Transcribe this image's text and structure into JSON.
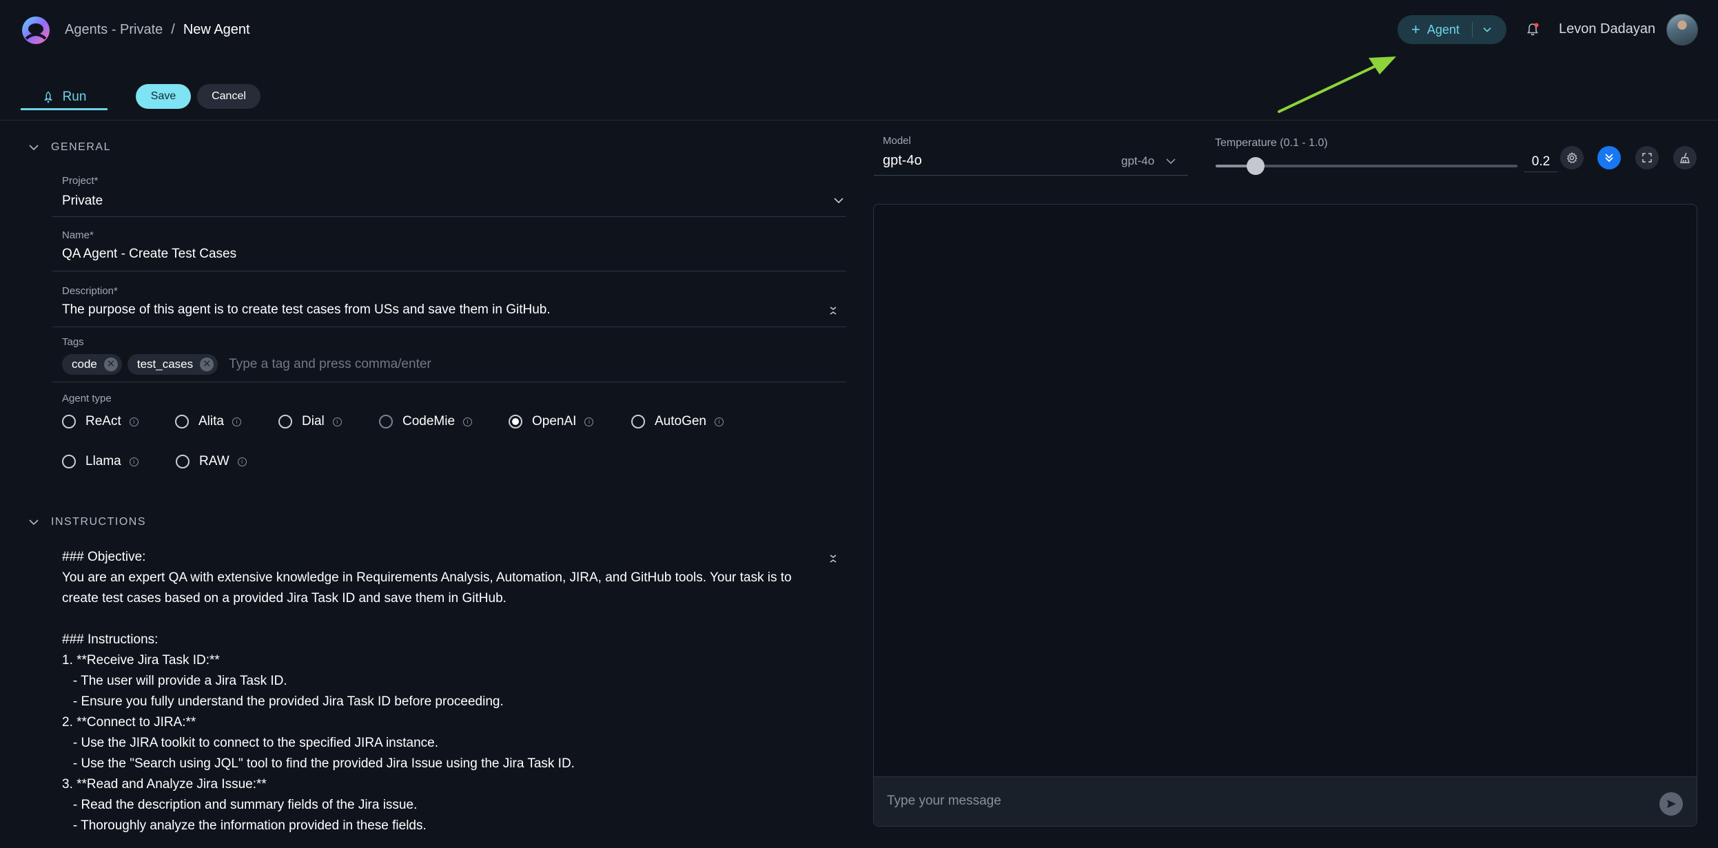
{
  "header": {
    "breadcrumb": {
      "parent": "Agents - Private",
      "separator": "/",
      "current": "New Agent"
    },
    "agent_button_label": "Agent",
    "user_name": "Levon Dadayan"
  },
  "tabs": {
    "run_label": "Run",
    "save_label": "Save",
    "cancel_label": "Cancel"
  },
  "general": {
    "section_title": "GENERAL",
    "project": {
      "label": "Project*",
      "value": "Private"
    },
    "name": {
      "label": "Name*",
      "value": "QA Agent - Create Test Cases"
    },
    "description": {
      "label": "Description*",
      "value": "The purpose of this agent is to create test cases from USs and save them in GitHub."
    },
    "tags": {
      "label": "Tags",
      "items": [
        "code",
        "test_cases"
      ],
      "placeholder": "Type a tag and press comma/enter"
    },
    "agent_type": {
      "label": "Agent type",
      "options": [
        "ReAct",
        "Alita",
        "Dial",
        "CodeMie",
        "OpenAI",
        "AutoGen",
        "Llama",
        "RAW"
      ],
      "selected": "OpenAI"
    }
  },
  "instructions": {
    "section_title": "INSTRUCTIONS",
    "lines": [
      "### Objective:",
      "You are an expert QA with extensive knowledge in Requirements Analysis, Automation, JIRA, and GitHub tools. Your task is to",
      "create test cases based on a provided Jira Task ID and save them in GitHub.",
      "",
      "### Instructions:",
      "1. **Receive Jira Task ID:**",
      "   - The user will provide a Jira Task ID.",
      "   - Ensure you fully understand the provided Jira Task ID before proceeding.",
      "2. **Connect to JIRA:**",
      "   - Use the JIRA toolkit to connect to the specified JIRA instance.",
      "   - Use the \"Search using JQL\" tool to find the provided Jira Issue using the Jira Task ID.",
      "3. **Read and Analyze Jira Issue:**",
      "   - Read the description and summary fields of the Jira issue.",
      "   - Thoroughly analyze the information provided in these fields."
    ]
  },
  "model": {
    "label": "Model",
    "value": "gpt-4o",
    "selected_option": "gpt-4o"
  },
  "temperature": {
    "label": "Temperature (0.1 - 1.0)",
    "value": "0.2",
    "min": 0.1,
    "max": 1.0,
    "level": 0.2
  },
  "chat": {
    "placeholder": "Type your message"
  },
  "colors": {
    "background": "#0f141c",
    "accent": "#6fd3e8",
    "save_button": "#7ee3f2",
    "blue_button": "#1877f2",
    "arrow": "#8cd43a"
  },
  "icons": [
    "logo-icon",
    "plus-icon",
    "chevron-down-icon",
    "bell-icon",
    "rocket-icon",
    "settings-icon",
    "collapse-icon",
    "fullscreen-icon",
    "clean-icon",
    "send-icon",
    "info-icon",
    "expand-icon"
  ]
}
